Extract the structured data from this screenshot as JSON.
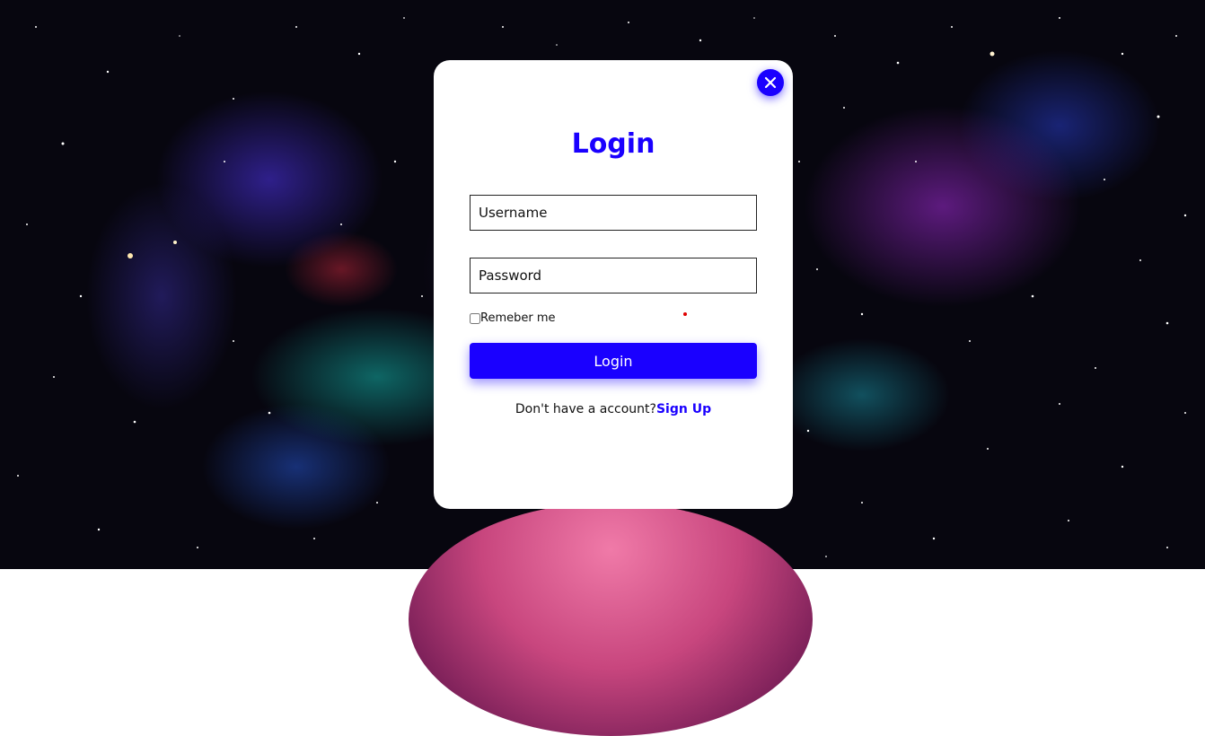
{
  "login_modal": {
    "title": "Login",
    "username_placeholder": "Username",
    "password_placeholder": "Password",
    "remember_label": "Remeber me",
    "remember_checked": false,
    "submit_label": "Login",
    "no_account_text": "Don't have a account?",
    "signup_link": "Sign Up",
    "close_icon": "close-icon"
  },
  "colors": {
    "accent": "#1a00ff",
    "card_background": "#ffffff"
  }
}
